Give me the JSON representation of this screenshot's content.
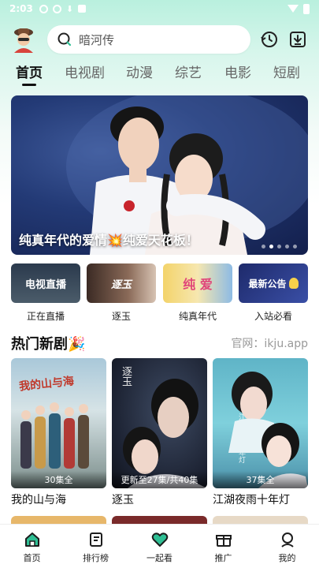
{
  "status_bar": {
    "time": "2:03"
  },
  "header": {
    "search_placeholder": "暗河传"
  },
  "tabs": [
    {
      "label": "首页",
      "active": true
    },
    {
      "label": "电视剧"
    },
    {
      "label": "动漫"
    },
    {
      "label": "综艺"
    },
    {
      "label": "电影"
    },
    {
      "label": "短剧"
    }
  ],
  "banner": {
    "caption": "纯真年代的爱情💥纯爱天花板！",
    "slide_count": 5,
    "active_slide": 1
  },
  "quick_links": [
    {
      "label": "正在直播",
      "thumb_text": "电视直播"
    },
    {
      "label": "逐玉",
      "thumb_text": "逐玉"
    },
    {
      "label": "纯真年代",
      "thumb_text": "纯 爱"
    },
    {
      "label": "入站必看",
      "thumb_text": "最新公告"
    }
  ],
  "section": {
    "title": "热门新剧🎉",
    "meta": "官网：ikju.app"
  },
  "cards": [
    {
      "name": "我的山与海",
      "episodes": "30集全",
      "poster_text": "我的山与海"
    },
    {
      "name": "逐玉",
      "episodes": "更新至27集/共40集",
      "poster_text": "逐玉"
    },
    {
      "name": "江湖夜雨十年灯",
      "episodes": "37集全",
      "poster_text": "江湖夜雨十年灯"
    }
  ],
  "bottom_nav": [
    {
      "label": "首页",
      "icon": "home-icon"
    },
    {
      "label": "排行榜",
      "icon": "ranking-icon"
    },
    {
      "label": "一起看",
      "icon": "heart-icon"
    },
    {
      "label": "推广",
      "icon": "gift-icon"
    },
    {
      "label": "我的",
      "icon": "profile-icon"
    }
  ],
  "colors": {
    "accent": "#2fbf94",
    "header_bg": "#b9f0de",
    "active_tab": "#111111"
  }
}
